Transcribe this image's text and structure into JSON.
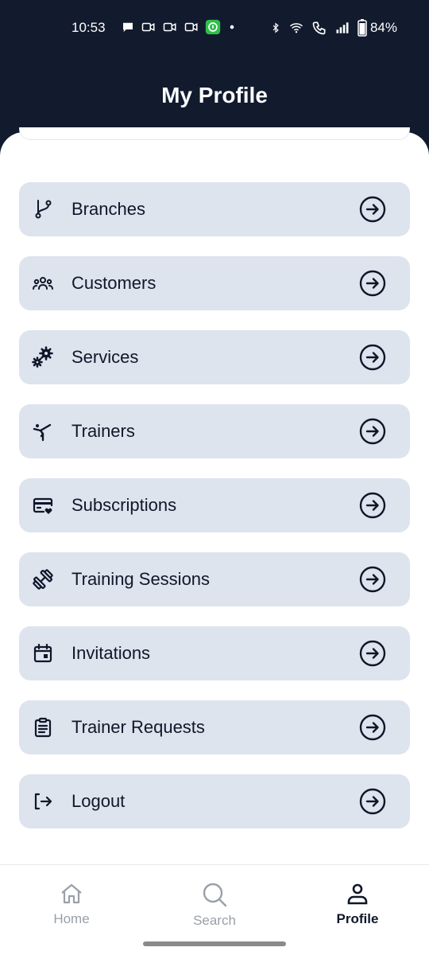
{
  "status_bar": {
    "time": "10:53",
    "battery": "84%",
    "notification_icons": [
      "chat-bubble-icon",
      "video-icon",
      "video-icon",
      "video-icon",
      "app-notification-icon",
      "dot-icon"
    ],
    "system_icons": [
      "bluetooth-icon",
      "wifi-icon",
      "wifi-call-icon",
      "signal-icon",
      "battery-icon"
    ]
  },
  "header": {
    "title": "My Profile"
  },
  "menu": {
    "items": [
      {
        "label": "Branches",
        "icon": "branch-icon"
      },
      {
        "label": "Customers",
        "icon": "group-icon"
      },
      {
        "label": "Services",
        "icon": "gears-icon"
      },
      {
        "label": "Trainers",
        "icon": "gymnast-icon"
      },
      {
        "label": "Subscriptions",
        "icon": "card-heart-icon"
      },
      {
        "label": "Training Sessions",
        "icon": "dumbbell-icon"
      },
      {
        "label": "Invitations",
        "icon": "calendar-icon"
      },
      {
        "label": "Trainer Requests",
        "icon": "clipboard-icon"
      },
      {
        "label": "Logout",
        "icon": "logout-icon"
      }
    ],
    "arrow_icon": "arrow-right-circle-icon"
  },
  "bottom_nav": {
    "items": [
      {
        "label": "Home",
        "icon": "home-icon",
        "active": false
      },
      {
        "label": "Search",
        "icon": "search-icon",
        "active": false
      },
      {
        "label": "Profile",
        "icon": "user-icon",
        "active": true
      }
    ]
  },
  "colors": {
    "header_bg": "#121a2e",
    "item_bg": "#dde4ed",
    "text": "#0f172a",
    "nav_inactive": "#9aa0a8"
  }
}
